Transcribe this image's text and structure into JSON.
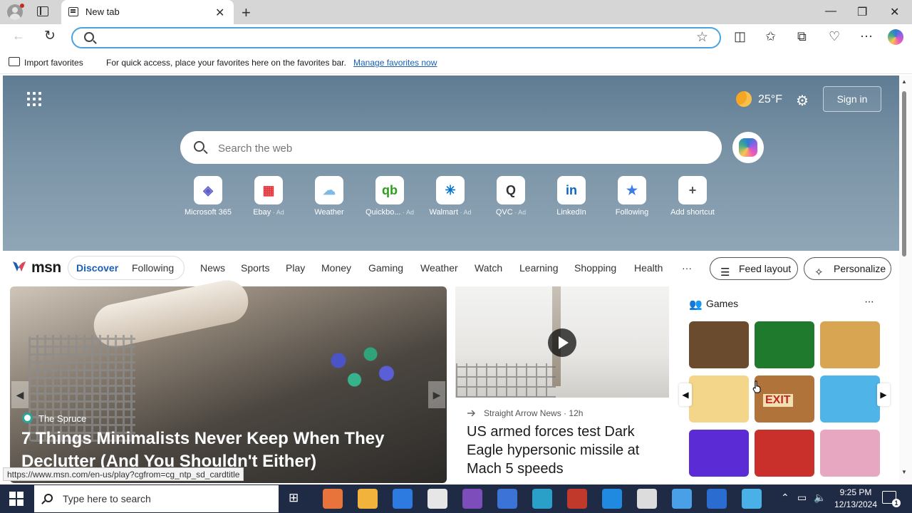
{
  "browser": {
    "tab_title": "New tab",
    "address_value": "",
    "tab_close_glyph": "✕",
    "new_tab_glyph": "+",
    "minimize_glyph": "—",
    "restore_glyph": "❐",
    "close_glyph": "✕"
  },
  "favorites_bar": {
    "import_label": "Import favorites",
    "hint": "For quick access, place your favorites here on the favorites bar.",
    "manage_link": "Manage favorites now"
  },
  "hero": {
    "temperature": "25°F",
    "sign_in": "Sign in",
    "search_placeholder": "Search the web"
  },
  "shortcuts": [
    {
      "label": "Microsoft 365",
      "ad": "",
      "glyph": "◈",
      "color": "#5b5fc7"
    },
    {
      "label": "Ebay",
      "ad": " · Ad",
      "glyph": "▦",
      "color": "#e53238"
    },
    {
      "label": "Weather",
      "ad": "",
      "glyph": "☁",
      "color": "#7fb9e6"
    },
    {
      "label": "Quickbo...",
      "ad": " · Ad",
      "glyph": "qb",
      "color": "#2ca01c"
    },
    {
      "label": "Walmart",
      "ad": " · Ad",
      "glyph": "✳",
      "color": "#0071ce"
    },
    {
      "label": "QVC",
      "ad": " · Ad",
      "glyph": "Q",
      "color": "#333333"
    },
    {
      "label": "LinkedIn",
      "ad": "",
      "glyph": "in",
      "color": "#0a66c2"
    },
    {
      "label": "Following",
      "ad": "",
      "glyph": "★",
      "color": "#3c7be0"
    },
    {
      "label": "Add shortcut",
      "ad": "",
      "glyph": "+",
      "color": "#555555"
    }
  ],
  "msn": {
    "logo": "msn",
    "tabs": [
      "Discover",
      "Following"
    ],
    "nav": [
      "News",
      "Sports",
      "Play",
      "Money",
      "Gaming",
      "Weather",
      "Watch",
      "Learning",
      "Shopping",
      "Health"
    ],
    "more": "···",
    "feed_layout": "Feed layout",
    "personalize": "Personalize"
  },
  "main_card": {
    "source": "The Spruce",
    "headline": "7 Things Minimalists Never Keep When They Declutter (And You Shouldn't Either)"
  },
  "status_url": "https://www.msn.com/en-us/play?cgfrom=cg_ntp_sd_cardtitle",
  "side_card": {
    "source": "Straight Arrow News",
    "age": "12h",
    "headline": "US armed forces test Dark Eagle hypersonic missile at Mach 5 speeds"
  },
  "games": {
    "title": "Games",
    "more": "···",
    "exit_label": "EXIT",
    "tiles": [
      "#6b4b2e",
      "#1f7a2e",
      "#d8a552",
      "#f3d68a",
      "#b0743a",
      "#4fb4e8",
      "#5b2bd6",
      "#c9302c",
      "#e7a7c0"
    ]
  },
  "taskbar": {
    "search_placeholder": "Type here to search",
    "time": "9:25 PM",
    "date": "12/13/2024",
    "notification_count": "1",
    "apps": [
      "#e8743b",
      "#f2b33d",
      "#2d7be0",
      "#e6e6e6",
      "#7c4dbb",
      "#3b73d6",
      "#2aa0c8",
      "#c0392b",
      "#1f8ae0",
      "#dcdcdc",
      "#4aa0e6",
      "#2b6cd0",
      "#4ab0e8"
    ]
  }
}
